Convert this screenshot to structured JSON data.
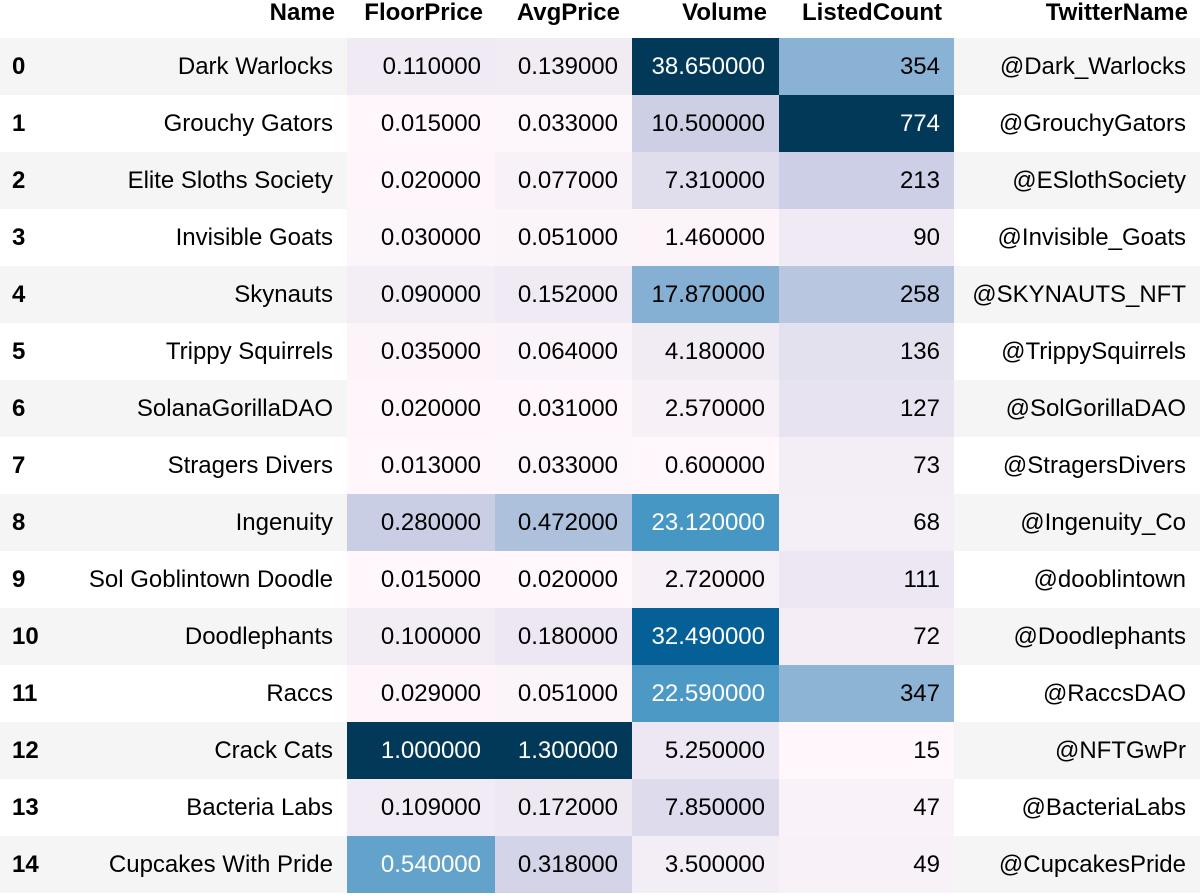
{
  "columns": [
    "Name",
    "FloorPrice",
    "AvgPrice",
    "Volume",
    "ListedCount",
    "TwitterName"
  ],
  "rows": [
    {
      "index": "0",
      "name": "Dark Warlocks",
      "floor": "0.110000",
      "avg": "0.139000",
      "volume": "38.650000",
      "listed": "354",
      "twitter": "@Dark_Warlocks"
    },
    {
      "index": "1",
      "name": "Grouchy Gators",
      "floor": "0.015000",
      "avg": "0.033000",
      "volume": "10.500000",
      "listed": "774",
      "twitter": "@GrouchyGators"
    },
    {
      "index": "2",
      "name": "Elite Sloths Society",
      "floor": "0.020000",
      "avg": "0.077000",
      "volume": "7.310000",
      "listed": "213",
      "twitter": "@ESlothSociety"
    },
    {
      "index": "3",
      "name": "Invisible Goats",
      "floor": "0.030000",
      "avg": "0.051000",
      "volume": "1.460000",
      "listed": "90",
      "twitter": "@Invisible_Goats"
    },
    {
      "index": "4",
      "name": "Skynauts",
      "floor": "0.090000",
      "avg": "0.152000",
      "volume": "17.870000",
      "listed": "258",
      "twitter": "@SKYNAUTS_NFT"
    },
    {
      "index": "5",
      "name": "Trippy Squirrels",
      "floor": "0.035000",
      "avg": "0.064000",
      "volume": "4.180000",
      "listed": "136",
      "twitter": "@TrippySquirrels"
    },
    {
      "index": "6",
      "name": "SolanaGorillaDAO",
      "floor": "0.020000",
      "avg": "0.031000",
      "volume": "2.570000",
      "listed": "127",
      "twitter": "@SolGorillaDAO"
    },
    {
      "index": "7",
      "name": "Stragers Divers",
      "floor": "0.013000",
      "avg": "0.033000",
      "volume": "0.600000",
      "listed": "73",
      "twitter": "@StragersDivers"
    },
    {
      "index": "8",
      "name": "Ingenuity",
      "floor": "0.280000",
      "avg": "0.472000",
      "volume": "23.120000",
      "listed": "68",
      "twitter": "@Ingenuity_Co"
    },
    {
      "index": "9",
      "name": "Sol Goblintown Doodle",
      "floor": "0.015000",
      "avg": "0.020000",
      "volume": "2.720000",
      "listed": "111",
      "twitter": "@dooblintown"
    },
    {
      "index": "10",
      "name": "Doodlephants",
      "floor": "0.100000",
      "avg": "0.180000",
      "volume": "32.490000",
      "listed": "72",
      "twitter": "@Doodlephants"
    },
    {
      "index": "11",
      "name": "Raccs",
      "floor": "0.029000",
      "avg": "0.051000",
      "volume": "22.590000",
      "listed": "347",
      "twitter": "@RaccsDAO"
    },
    {
      "index": "12",
      "name": "Crack Cats",
      "floor": "1.000000",
      "avg": "1.300000",
      "volume": "5.250000",
      "listed": "15",
      "twitter": "@NFTGwPr"
    },
    {
      "index": "13",
      "name": "Bacteria Labs",
      "floor": "0.109000",
      "avg": "0.172000",
      "volume": "7.850000",
      "listed": "47",
      "twitter": "@BacteriaLabs"
    },
    {
      "index": "14",
      "name": "Cupcakes With Pride",
      "floor": "0.540000",
      "avg": "0.318000",
      "volume": "3.500000",
      "listed": "49",
      "twitter": "@CupcakesPride"
    }
  ],
  "colors": {
    "stripe": "#f5f5f5",
    "text_dark": "#000000",
    "text_light": "#ffffff",
    "gradient": [
      "#fff7fb",
      "#ece7f2",
      "#d0d1e6",
      "#a6bddb",
      "#74a9cf",
      "#3690c0",
      "#0570b0",
      "#045a8d",
      "#023858"
    ]
  }
}
